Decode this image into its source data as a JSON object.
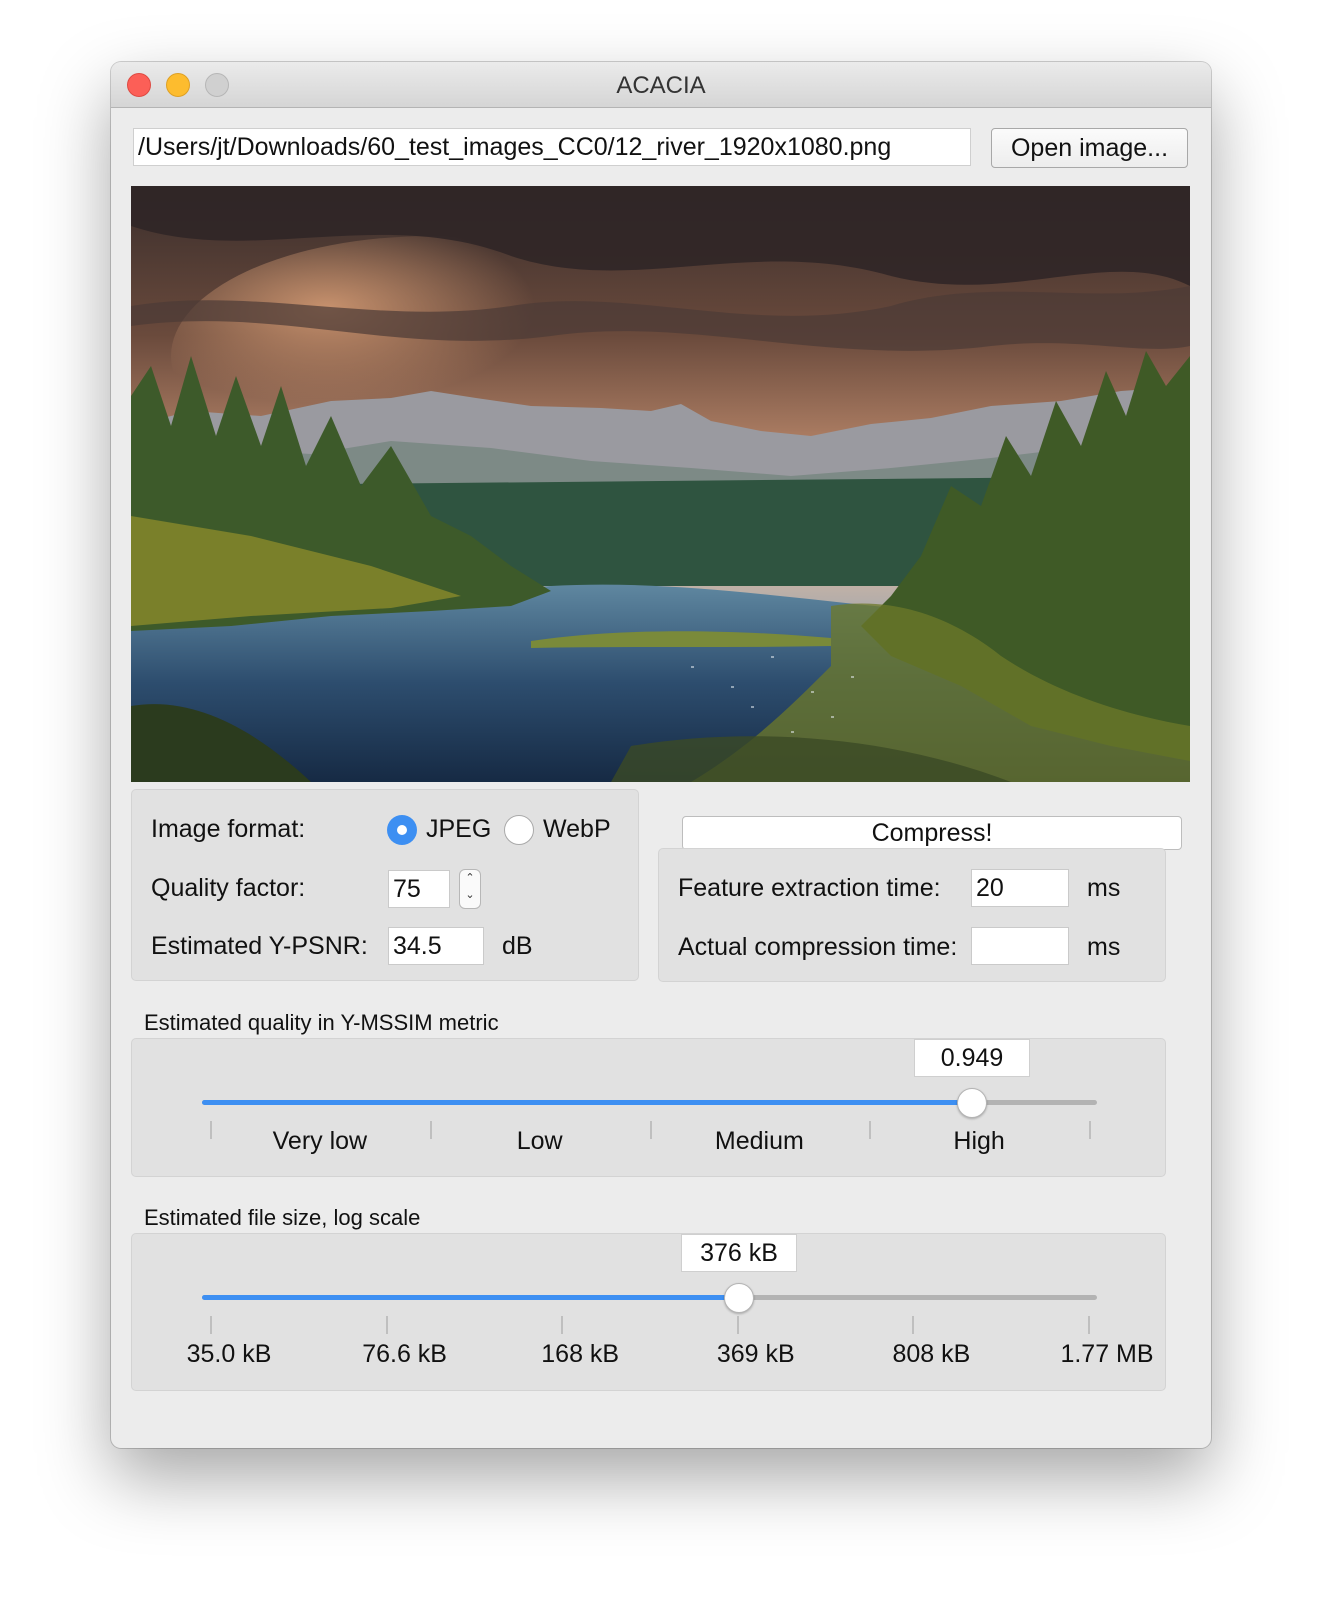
{
  "window": {
    "title": "ACACIA"
  },
  "file": {
    "path": "/Users/jt/Downloads/60_test_images_CC0/12_river_1920x1080.png",
    "open_button": "Open image..."
  },
  "format": {
    "label": "Image format:",
    "options": [
      "JPEG",
      "WebP"
    ],
    "selected": "JPEG",
    "quality_label": "Quality factor:",
    "quality_value": "75",
    "psnr_label": "Estimated Y-PSNR:",
    "psnr_value": "34.5",
    "psnr_unit": "dB"
  },
  "compress": {
    "button": "Compress!",
    "feature_label": "Feature extraction time:",
    "feature_value": "20",
    "feature_unit": "ms",
    "actual_label": "Actual compression time:",
    "actual_value": "",
    "actual_unit": "ms"
  },
  "quality_slider": {
    "title": "Estimated quality in Y-MSSIM metric",
    "value": "0.949",
    "position_fraction": 0.86,
    "labels": [
      "Very low",
      "Low",
      "Medium",
      "High"
    ]
  },
  "size_slider": {
    "title": "Estimated file size, log scale",
    "value": "376 kB",
    "position_fraction": 0.6,
    "labels": [
      "35.0 kB",
      "76.6 kB",
      "168 kB",
      "369 kB",
      "808 kB",
      "1.77 MB"
    ]
  },
  "colors": {
    "accent": "#3d8ff2",
    "close": "#fc5f57",
    "minimize": "#fdbc2e"
  }
}
